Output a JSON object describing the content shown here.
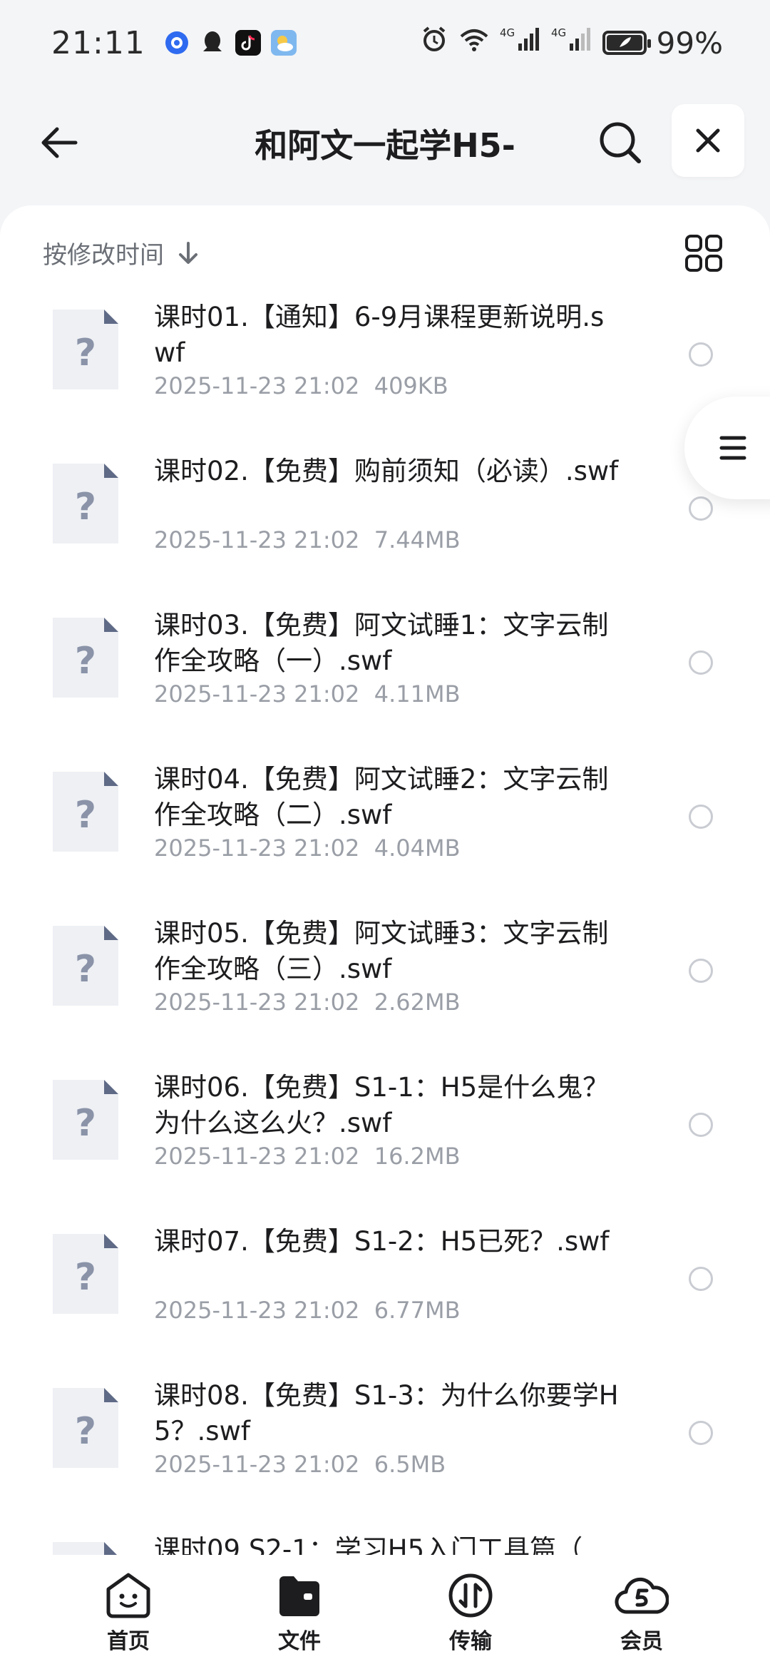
{
  "status_bar": {
    "time": "21:11",
    "battery": "99%",
    "notification_icons": [
      "browser-icon",
      "qq-icon",
      "tiktok-icon",
      "weather-icon"
    ],
    "system_icons": [
      "alarm-icon",
      "wifi-icon",
      "4g-signal-icon",
      "4g-signal-icon",
      "battery-icon"
    ]
  },
  "header": {
    "title": "和阿文一起学H5-"
  },
  "sort": {
    "label": "按修改时间"
  },
  "files": [
    {
      "name": "课时01.【通知】6-9月课程更新说明.swf",
      "date": "2025-11-23 21:02",
      "size": "409KB"
    },
    {
      "name": "课时02.【免费】购前须知（必读）.swf",
      "date": "2025-11-23 21:02",
      "size": "7.44MB"
    },
    {
      "name": "课时03.【免费】阿文试睡1：文字云制作全攻略（一）.swf",
      "date": "2025-11-23 21:02",
      "size": "4.11MB"
    },
    {
      "name": "课时04.【免费】阿文试睡2：文字云制作全攻略（二）.swf",
      "date": "2025-11-23 21:02",
      "size": "4.04MB"
    },
    {
      "name": "课时05.【免费】阿文试睡3：文字云制作全攻略（三）.swf",
      "date": "2025-11-23 21:02",
      "size": "2.62MB"
    },
    {
      "name": "课时06.【免费】S1-1：H5是什么鬼？为什么这么火？.swf",
      "date": "2025-11-23 21:02",
      "size": "16.2MB"
    },
    {
      "name": "课时07.【免费】S1-2：H5已死？.swf",
      "date": "2025-11-23 21:02",
      "size": "6.77MB"
    },
    {
      "name": "课时08.【免费】S1-3：为什么你要学H5？.swf",
      "date": "2025-11-23 21:02",
      "size": "6.5MB"
    },
    {
      "name": "课时09.S2-1：学习H5入门工具篇（",
      "date": "",
      "size": ""
    }
  ],
  "tabs": [
    {
      "label": "首页",
      "icon": "home-face-icon"
    },
    {
      "label": "文件",
      "icon": "folder-icon"
    },
    {
      "label": "传输",
      "icon": "transfer-icon"
    },
    {
      "label": "会员",
      "icon": "vip-cloud-icon"
    }
  ],
  "colors": {
    "accent": "#1d1d1f",
    "meta_text": "#9a9ea6",
    "background": "#f4f5f7"
  }
}
